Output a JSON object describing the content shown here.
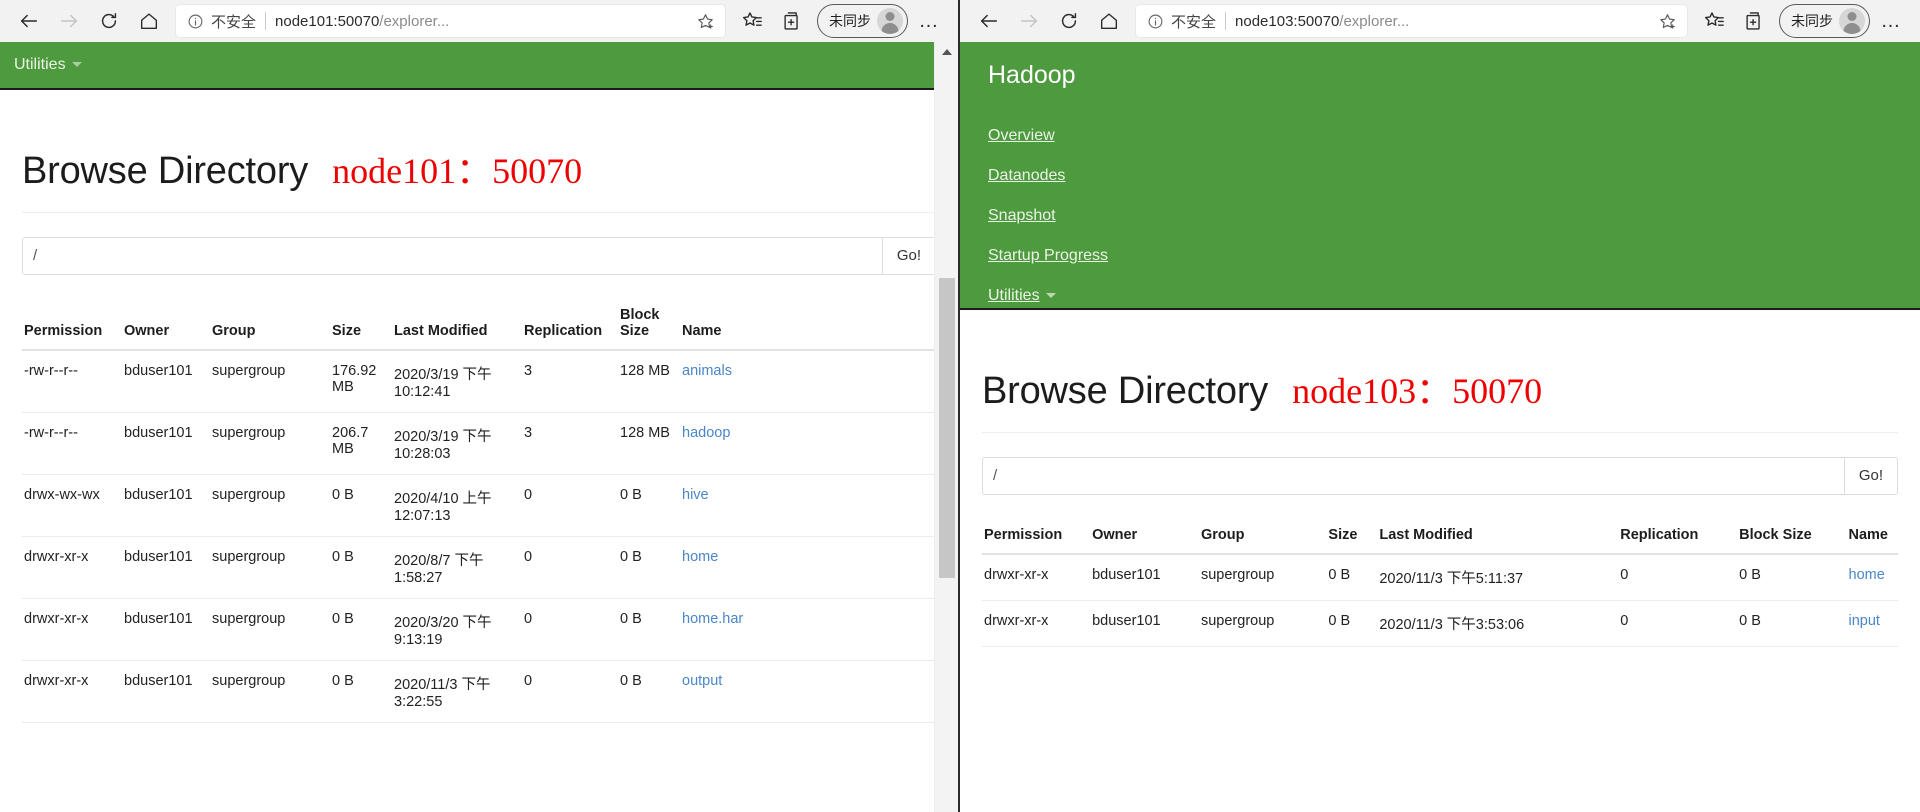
{
  "windows": [
    {
      "id": "left",
      "browser": {
        "back_label": "Back",
        "forward_label": "Forward",
        "refresh_label": "Refresh",
        "home_label": "Home",
        "security_text": "不安全",
        "url": "node101:50070/explorer...",
        "url_host": "node101:50070",
        "url_path": "/explorer...",
        "favorite_label": "Add to favorites",
        "collections_label": "Collections",
        "favorites_label": "Favorites",
        "profile_label": "未同步",
        "more_label": "…"
      },
      "nav": {
        "style": "short",
        "utilities_label": "Utilities"
      },
      "page": {
        "title": "Browse Directory",
        "subtitle": "node101：50070",
        "path_value": "/",
        "path_placeholder": "/",
        "go_label": "Go!",
        "columns": [
          "Permission",
          "Owner",
          "Group",
          "Size",
          "Last Modified",
          "Replication",
          "Block Size",
          "Name"
        ],
        "rows": [
          [
            "-rw-r--r--",
            "bduser101",
            "supergroup",
            "176.92 MB",
            "2020/3/19 下午 10:12:41",
            "3",
            "128 MB",
            "animals"
          ],
          [
            "-rw-r--r--",
            "bduser101",
            "supergroup",
            "206.7 MB",
            "2020/3/19 下午 10:28:03",
            "3",
            "128 MB",
            "hadoop"
          ],
          [
            "drwx-wx-wx",
            "bduser101",
            "supergroup",
            "0 B",
            "2020/4/10 上午 12:07:13",
            "0",
            "0 B",
            "hive"
          ],
          [
            "drwxr-xr-x",
            "bduser101",
            "supergroup",
            "0 B",
            "2020/8/7 下午 1:58:27",
            "0",
            "0 B",
            "home"
          ],
          [
            "drwxr-xr-x",
            "bduser101",
            "supergroup",
            "0 B",
            "2020/3/20 下午 9:13:19",
            "0",
            "0 B",
            "home.har"
          ],
          [
            "drwxr-xr-x",
            "bduser101",
            "supergroup",
            "0 B",
            "2020/11/3 下午 3:22:55",
            "0",
            "0 B",
            "output"
          ]
        ]
      }
    },
    {
      "id": "right",
      "browser": {
        "back_label": "Back",
        "forward_label": "Forward",
        "refresh_label": "Refresh",
        "home_label": "Home",
        "security_text": "不安全",
        "url": "node103:50070/explorer...",
        "url_host": "node103:50070",
        "url_path": "/explorer...",
        "favorite_label": "Add to favorites",
        "collections_label": "Collections",
        "favorites_label": "Favorites",
        "profile_label": "未同步",
        "more_label": "…"
      },
      "nav": {
        "style": "tall",
        "brand": "Hadoop",
        "items": [
          {
            "label": "Overview",
            "has_caret": false
          },
          {
            "label": "Datanodes",
            "has_caret": false
          },
          {
            "label": "Snapshot",
            "has_caret": false
          },
          {
            "label": "Startup Progress",
            "has_caret": false
          },
          {
            "label": "Utilities",
            "has_caret": true
          }
        ]
      },
      "page": {
        "title": "Browse Directory",
        "subtitle": "node103：50070",
        "path_value": "/",
        "path_placeholder": "/",
        "go_label": "Go!",
        "columns": [
          "Permission",
          "Owner",
          "Group",
          "Size",
          "Last Modified",
          "Replication",
          "Block Size",
          "Name"
        ],
        "rows": [
          [
            "drwxr-xr-x",
            "bduser101",
            "supergroup",
            "0 B",
            "2020/11/3 下午5:11:37",
            "0",
            "0 B",
            "home"
          ],
          [
            "drwxr-xr-x",
            "bduser101",
            "supergroup",
            "0 B",
            "2020/11/3 下午3:53:06",
            "0",
            "0 B",
            "input"
          ]
        ]
      }
    }
  ],
  "colors": {
    "hadoop_green": "#4e9a3e",
    "subtitle_red": "#ef0000",
    "link_blue": "#4a86c8",
    "toolbar_gray": "#f2f2f2"
  }
}
